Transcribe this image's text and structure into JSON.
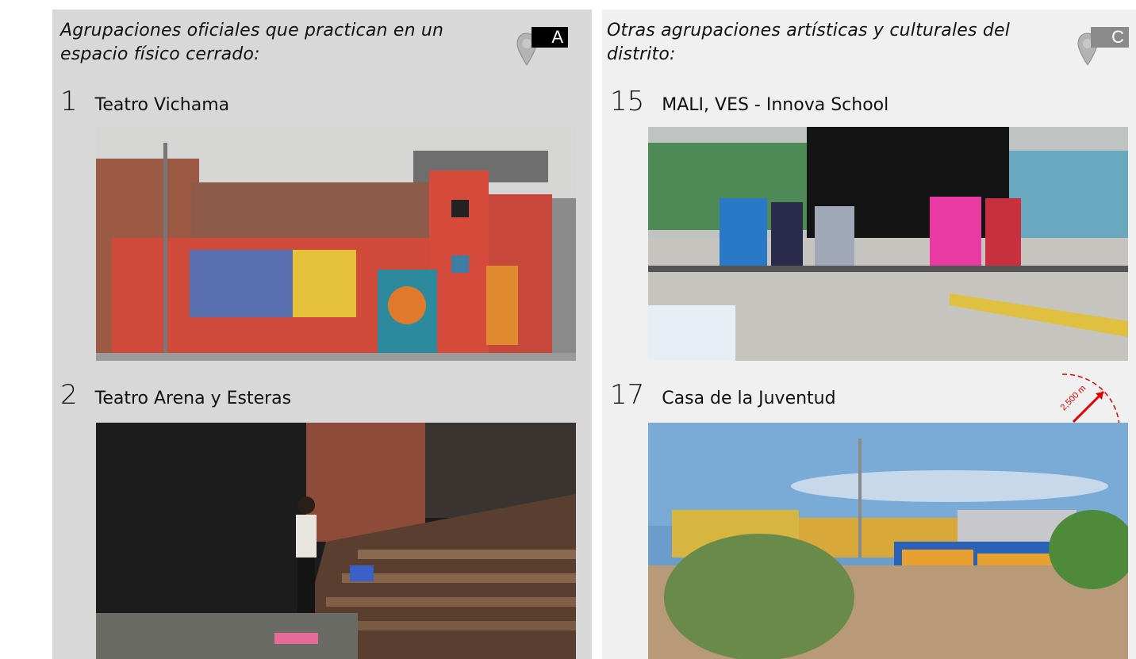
{
  "left_panel": {
    "heading": "Agrupaciones oficiales que practican en un espacio físico cerrado:",
    "badge": "A",
    "items": [
      {
        "number": "1",
        "name": "Teatro Vichama",
        "photo": "teatro-vichama-photo"
      },
      {
        "number": "2",
        "name": "Teatro Arena y Esteras",
        "photo": "teatro-arena-photo"
      }
    ]
  },
  "right_panel": {
    "heading": "Otras agrupaciones artísticas y culturales del distrito:",
    "badge": "C",
    "items": [
      {
        "number": "15",
        "name": "MALI, VES - Innova School",
        "photo": "mali-ves-photo"
      },
      {
        "number": "17",
        "name": "Casa de la Juventud",
        "photo": "casa-juventud-photo"
      }
    ],
    "scale_label": "2,500 m"
  },
  "colors": {
    "left_panel_bg": "#d8d8d8",
    "right_panel_bg": "#f0f0f0",
    "badge_a": "#000000",
    "badge_c": "#8a8a8a",
    "pin": "#b0b0b0",
    "scale": "#e00000"
  }
}
